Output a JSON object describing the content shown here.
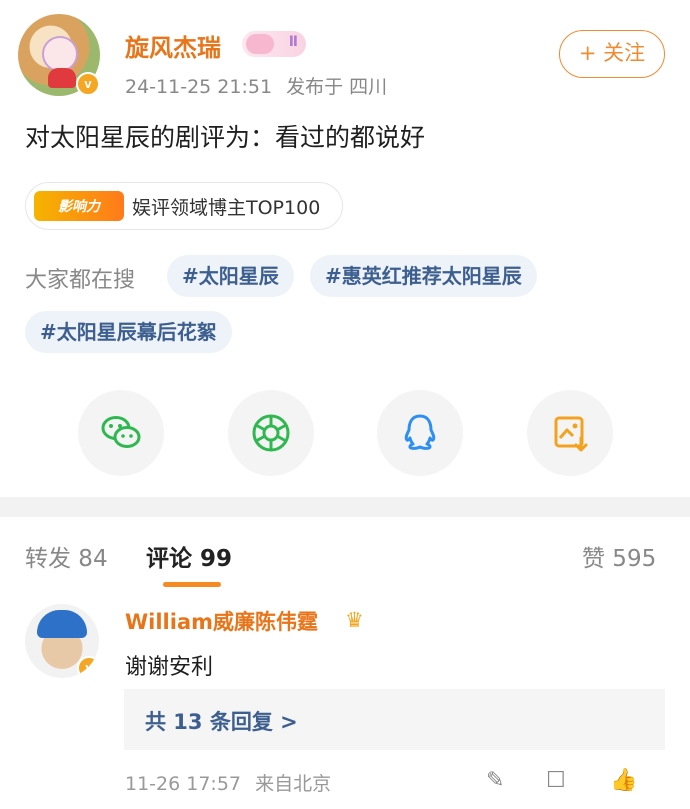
{
  "post": {
    "username": "旋风杰瑞",
    "level_badge": "Ⅱ",
    "timestamp": "24-11-25 21:51",
    "location": "发布于 四川",
    "follow_label": "+ 关注",
    "text": "对太阳星辰的剧评为：看过的都说好",
    "influence_badge": "影响力",
    "influence_text": "娱评领域博主TOP100",
    "trending_label": "大家都在搜",
    "tags": [
      "#太阳星辰",
      "#惠英红推荐太阳星辰",
      "#太阳星辰幕后花絮"
    ]
  },
  "share": [
    "wechat-icon",
    "moments-icon",
    "qq-icon",
    "save-image-icon"
  ],
  "tabs": {
    "repost": "转发 84",
    "comments": "评论 99",
    "likes": "赞 595"
  },
  "comment": {
    "username": "William威廉陈伟霆",
    "text": "谢谢安利",
    "replies": "共 13 条回复 >",
    "time": "11-26 17:57",
    "location": "来自北京"
  },
  "colors": {
    "accent": "#f58a23",
    "username": "#e8751a",
    "link": "#3d5f8f",
    "tag_bg": "#eef3f9"
  }
}
